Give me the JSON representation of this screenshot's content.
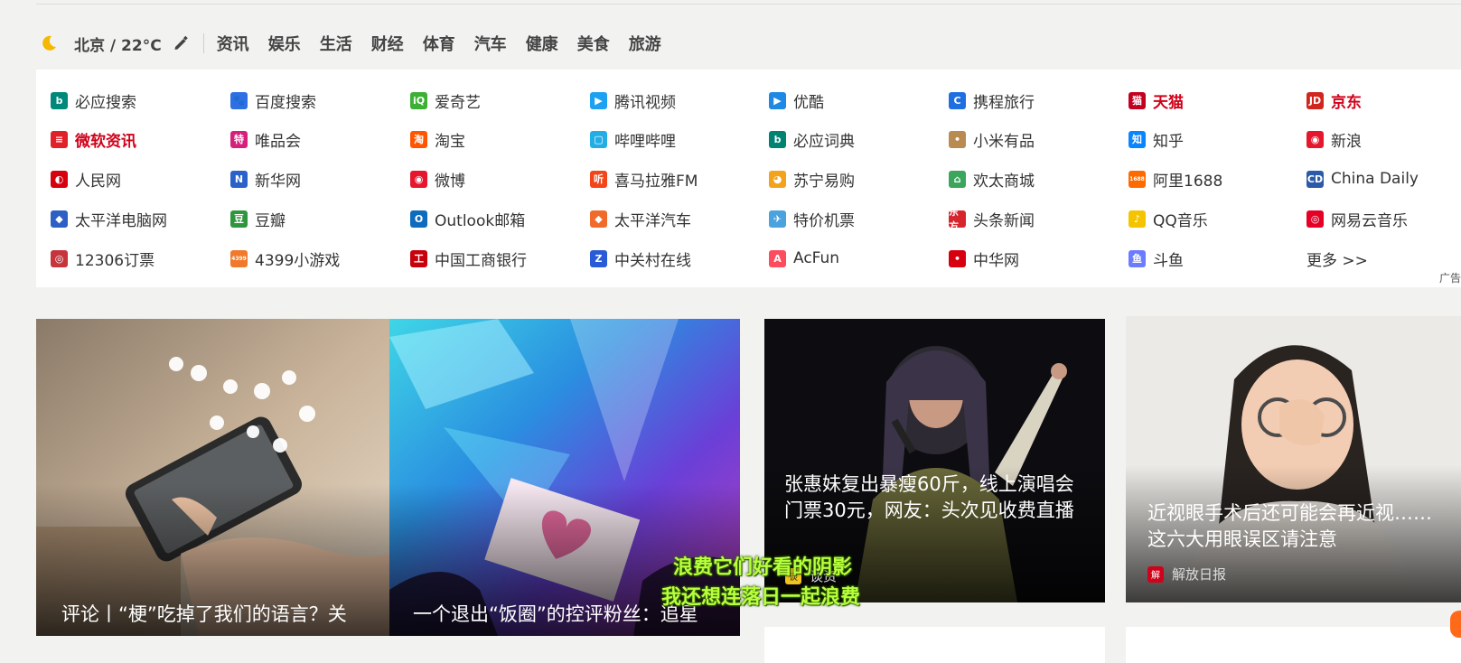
{
  "header": {
    "weather": "北京 / 22°C",
    "nav": [
      "资讯",
      "娱乐",
      "生活",
      "财经",
      "体育",
      "汽车",
      "健康",
      "美食",
      "旅游"
    ]
  },
  "links": [
    {
      "label": "必应搜索",
      "icon": "bing-icon",
      "color": "#00897b",
      "glyph": "b"
    },
    {
      "label": "百度搜索",
      "icon": "baidu-paw-icon",
      "color": "#2f6fe4",
      "glyph": "🐾"
    },
    {
      "label": "爱奇艺",
      "icon": "iqiyi-icon",
      "color": "#3cb034",
      "glyph": "iQ"
    },
    {
      "label": "腾讯视频",
      "icon": "tencent-video-icon",
      "color": "#1fa1f2",
      "glyph": "▶"
    },
    {
      "label": "优酷",
      "icon": "youku-icon",
      "color": "#1e88e5",
      "glyph": "▶"
    },
    {
      "label": "携程旅行",
      "icon": "ctrip-icon",
      "color": "#1f6fe0",
      "glyph": "C"
    },
    {
      "label": "天猫",
      "icon": "tmall-icon",
      "color": "#c2001f",
      "glyph": "猫",
      "red": true
    },
    {
      "label": "京东",
      "icon": "jd-icon",
      "color": "#d0261e",
      "glyph": "JD",
      "red": true
    },
    {
      "label": "微软资讯",
      "icon": "msn-news-icon",
      "color": "#e0212a",
      "glyph": "≡",
      "red": true
    },
    {
      "label": "唯品会",
      "icon": "vip-icon",
      "color": "#d6217c",
      "glyph": "特"
    },
    {
      "label": "淘宝",
      "icon": "taobao-icon",
      "color": "#ff5500",
      "glyph": "淘"
    },
    {
      "label": "哔哩哔哩",
      "icon": "bilibili-icon",
      "color": "#23ade5",
      "glyph": "▢"
    },
    {
      "label": "必应词典",
      "icon": "bing-dict-icon",
      "color": "#008373",
      "glyph": "b"
    },
    {
      "label": "小米有品",
      "icon": "xiaomi-youpin-icon",
      "color": "#b98b52",
      "glyph": "•"
    },
    {
      "label": "知乎",
      "icon": "zhihu-icon",
      "color": "#0a84ff",
      "glyph": "知"
    },
    {
      "label": "新浪",
      "icon": "sina-weibo-icon",
      "color": "#e6162d",
      "glyph": "◉"
    },
    {
      "label": "人民网",
      "icon": "people-daily-icon",
      "color": "#d7000f",
      "glyph": "◐"
    },
    {
      "label": "新华网",
      "icon": "xinhua-icon",
      "color": "#2a62c9",
      "glyph": "N"
    },
    {
      "label": "微博",
      "icon": "weibo-icon",
      "color": "#e6162d",
      "glyph": "◉"
    },
    {
      "label": "喜马拉雅FM",
      "icon": "ximalaya-icon",
      "color": "#f2451a",
      "glyph": "听"
    },
    {
      "label": "苏宁易购",
      "icon": "suning-icon",
      "color": "#f3a31b",
      "glyph": "◕"
    },
    {
      "label": "欢太商城",
      "icon": "heytap-icon",
      "color": "#3ba55c",
      "glyph": "⌂"
    },
    {
      "label": "阿里1688",
      "icon": "ali1688-icon",
      "color": "#ff6a00",
      "glyph": "1688"
    },
    {
      "label": "China Daily",
      "icon": "china-daily-icon",
      "color": "#2b5aa8",
      "glyph": "CD"
    },
    {
      "label": "太平洋电脑网",
      "icon": "pconline-icon",
      "color": "#2d5fc4",
      "glyph": "◆"
    },
    {
      "label": "豆瓣",
      "icon": "douban-icon",
      "color": "#2e963d",
      "glyph": "豆"
    },
    {
      "label": "Outlook邮箱",
      "icon": "outlook-icon",
      "color": "#0f6cbd",
      "glyph": "O"
    },
    {
      "label": "太平洋汽车",
      "icon": "pcauto-icon",
      "color": "#f06b2b",
      "glyph": "◆"
    },
    {
      "label": "特价机票",
      "icon": "plane-ticket-icon",
      "color": "#4aa3df",
      "glyph": "✈"
    },
    {
      "label": "头条新闻",
      "icon": "toutiao-news-icon",
      "color": "#d7252e",
      "glyph": "东方"
    },
    {
      "label": "QQ音乐",
      "icon": "qq-music-icon",
      "color": "#f5c400",
      "glyph": "♪"
    },
    {
      "label": "网易云音乐",
      "icon": "netease-music-icon",
      "color": "#e60026",
      "glyph": "◎"
    },
    {
      "label": "12306订票",
      "icon": "rail-12306-icon",
      "color": "#c6343c",
      "glyph": "◎"
    },
    {
      "label": "4399小游戏",
      "icon": "game-4399-icon",
      "color": "#f0792b",
      "glyph": "4399"
    },
    {
      "label": "中国工商银行",
      "icon": "icbc-icon",
      "color": "#c7000b",
      "glyph": "工"
    },
    {
      "label": "中关村在线",
      "icon": "zol-icon",
      "color": "#2a5bd7",
      "glyph": "Z"
    },
    {
      "label": "AcFun",
      "icon": "acfun-icon",
      "color": "#fd4c5d",
      "glyph": "A"
    },
    {
      "label": "中华网",
      "icon": "china-com-icon",
      "color": "#d7000f",
      "glyph": "•"
    },
    {
      "label": "斗鱼",
      "icon": "douyu-icon",
      "color": "#6b7cff",
      "glyph": "鱼"
    },
    {
      "label": "更多 >>",
      "icon": "",
      "color": "",
      "glyph": "",
      "more": true
    }
  ],
  "ad_label": "广告",
  "cards": [
    {
      "title": "评论丨“梗”吃掉了我们的语言？关"
    },
    {
      "title": "一个退出“饭圈”的控评粉丝：追星"
    },
    {
      "title": "张惠妹复出暴瘦60斤，线上演唱会门票30元，网友：头次见收费直播",
      "source": "谈资"
    },
    {
      "title": "近视眼手术后还可能会再近视……这六大用眼误区请注意",
      "source": "解放日报"
    }
  ],
  "subtitles": [
    "浪费它们好看的阴影",
    "我还想连落日一起浪费"
  ],
  "colors": {
    "accent_red": "#d0021b",
    "page_bg": "#f2f2f0",
    "subtitle_green": "#b7ff3d"
  }
}
